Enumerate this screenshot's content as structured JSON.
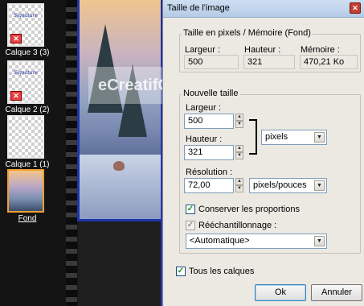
{
  "layers_panel": {
    "layers": [
      {
        "label": "Calque 3 (3)",
        "signature": "Signature"
      },
      {
        "label": "Calque 2 (2)",
        "signature": "Signature"
      },
      {
        "label": "Calque 1 (1)"
      },
      {
        "label": "Fond"
      }
    ]
  },
  "watermark": {
    "text": "eCreatifGraphic"
  },
  "dialog": {
    "title": "Taille de l'image",
    "close_glyph": "✕",
    "size_group": {
      "title": "Taille en pixels / Mémoire (Fond)",
      "width_label": "Largeur :",
      "height_label": "Hauteur :",
      "memory_label": "Mémoire :",
      "width_value": "500",
      "height_value": "321",
      "memory_value": "470,21 Ko"
    },
    "new_size_group": {
      "title": "Nouvelle taille",
      "width_label": "Largeur :",
      "width_value": "500",
      "height_label": "Hauteur :",
      "height_value": "321",
      "unit_value": "pixels",
      "resolution_label": "Résolution :",
      "resolution_value": "72,00",
      "resolution_unit": "pixels/pouces",
      "keep_proportions": "Conserver les proportions",
      "resample_label": "Rééchantillonnage :",
      "resample_value": "<Automatique>"
    },
    "all_layers": "Tous les calques",
    "ok": "Ok",
    "cancel": "Annuler"
  },
  "colors": {
    "dialog_bg": "#ece9e3",
    "title_bar": "#b5cbe6",
    "layer_selected_border": "#f0a030",
    "canvas_frame": "#2034a8"
  }
}
